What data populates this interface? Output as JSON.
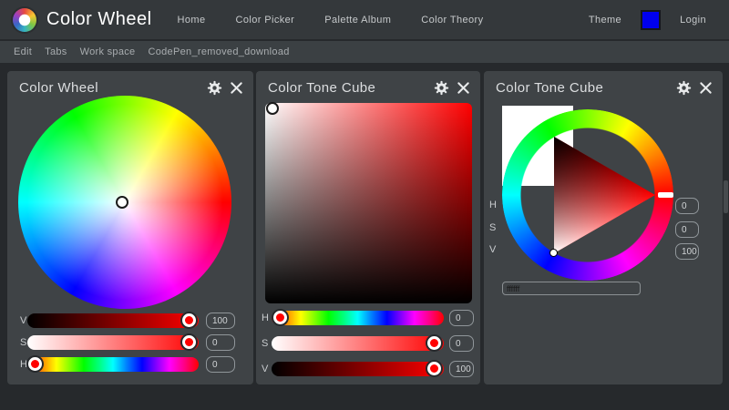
{
  "app": {
    "title": "Color Wheel"
  },
  "navbar": {
    "links": [
      {
        "label": "Home"
      },
      {
        "label": "Color Picker"
      },
      {
        "label": "Palette Album"
      },
      {
        "label": "Color Theory"
      }
    ],
    "theme_label": "Theme",
    "theme_swatch_color": "#0000ee",
    "login_label": "Login"
  },
  "menubar": {
    "items": [
      {
        "label": "Edit"
      },
      {
        "label": "Tabs"
      },
      {
        "label": "Work space"
      },
      {
        "label": "CodePen_removed_download"
      }
    ]
  },
  "panels": [
    {
      "title": "Color Wheel",
      "sliders": [
        {
          "label": "V",
          "value": "100"
        },
        {
          "label": "S",
          "value": "0"
        },
        {
          "label": "H",
          "value": "0"
        }
      ]
    },
    {
      "title": "Color Tone Cube",
      "sliders": [
        {
          "label": "H",
          "value": "0"
        },
        {
          "label": "S",
          "value": "0"
        },
        {
          "label": "V",
          "value": "100"
        }
      ]
    },
    {
      "title": "Color Tone Cube",
      "fields": [
        {
          "label": "H",
          "value": "0"
        },
        {
          "label": "S",
          "value": "0"
        },
        {
          "label": "V",
          "value": "100"
        }
      ],
      "hex_value": "ffffff"
    }
  ],
  "colors": {
    "accent_red": "#ff0000",
    "swatch_blue": "#0000ee",
    "page_bg": "#26292c",
    "panel_bg": "#3f4346",
    "navbar_bg": "#34383b",
    "menubar_bg": "#3b4043"
  }
}
